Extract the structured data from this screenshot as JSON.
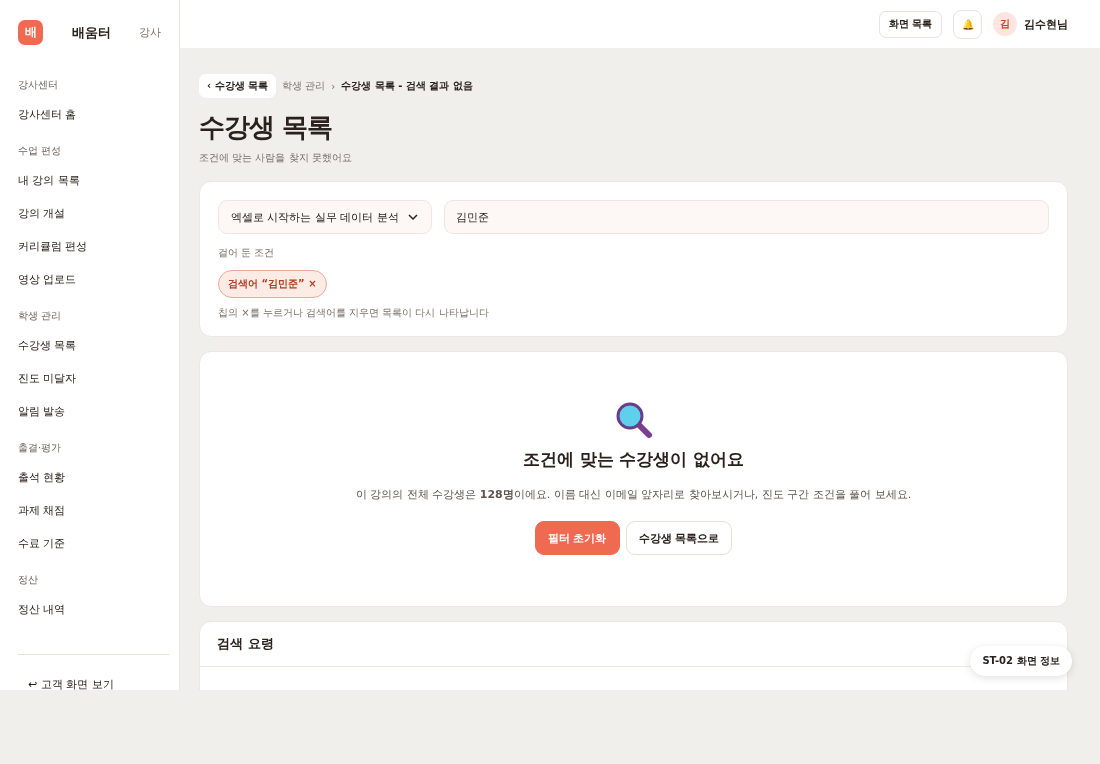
{
  "brand": {
    "logo": "배",
    "name": "배움터",
    "role": "강사"
  },
  "sidebar": {
    "groups": [
      {
        "title": "강사센터",
        "items": [
          "강사센터 홈"
        ]
      },
      {
        "title": "수업 편성",
        "items": [
          "내 강의 목록",
          "강의 개설",
          "커리큘럼 편성",
          "영상 업로드"
        ]
      },
      {
        "title": "학생 관리",
        "items": [
          "수강생 목록",
          "진도 미달자",
          "알림 발송"
        ]
      },
      {
        "title": "출결·평가",
        "items": [
          "출석 현황",
          "과제 채점",
          "수료 기준"
        ]
      },
      {
        "title": "정산",
        "items": [
          "정산 내역"
        ]
      }
    ],
    "footer_link": "↩ 고객 화면 보기"
  },
  "topbar": {
    "screens_button": "화면 목록",
    "bell": "🔔",
    "avatar": "김",
    "user": "김수현님"
  },
  "breadcrumb": {
    "back": "‹ 수강생 목록",
    "parent": "학생 관리",
    "separator": "›",
    "current": "수강생 목록 - 검색 결과 없음"
  },
  "page": {
    "title": "수강생 목록",
    "subtitle": "조건에 맞는 사람을 찾지 못했어요"
  },
  "filters": {
    "course_select": "엑셀로 시작하는 실무 데이터 분석",
    "search_value": "김민준",
    "applied_label": "걸어 둔 조건",
    "chips": [
      {
        "label": "검색어 “김민준”",
        "remove": "×"
      }
    ],
    "hint": "칩의 ×를 누르거나 검색어를 지우면 목록이 다시 나타납니다"
  },
  "empty_state": {
    "title": "조건에 맞는 수강생이 없어요",
    "message": "이 강의의 전체 수강생은 **128명**이에요. 이름 대신 이메일 앞자리로 찾아보시거나, 진도 구간 조건을 풀어 보세요.",
    "buttons": [
      {
        "label": "필터 초기화",
        "kind": "primary"
      },
      {
        "label": "수강생 목록으로",
        "kind": "secondary"
      }
    ]
  },
  "tips": {
    "title": "검색 요령"
  },
  "screen_info": "ST-02 화면 정보"
}
